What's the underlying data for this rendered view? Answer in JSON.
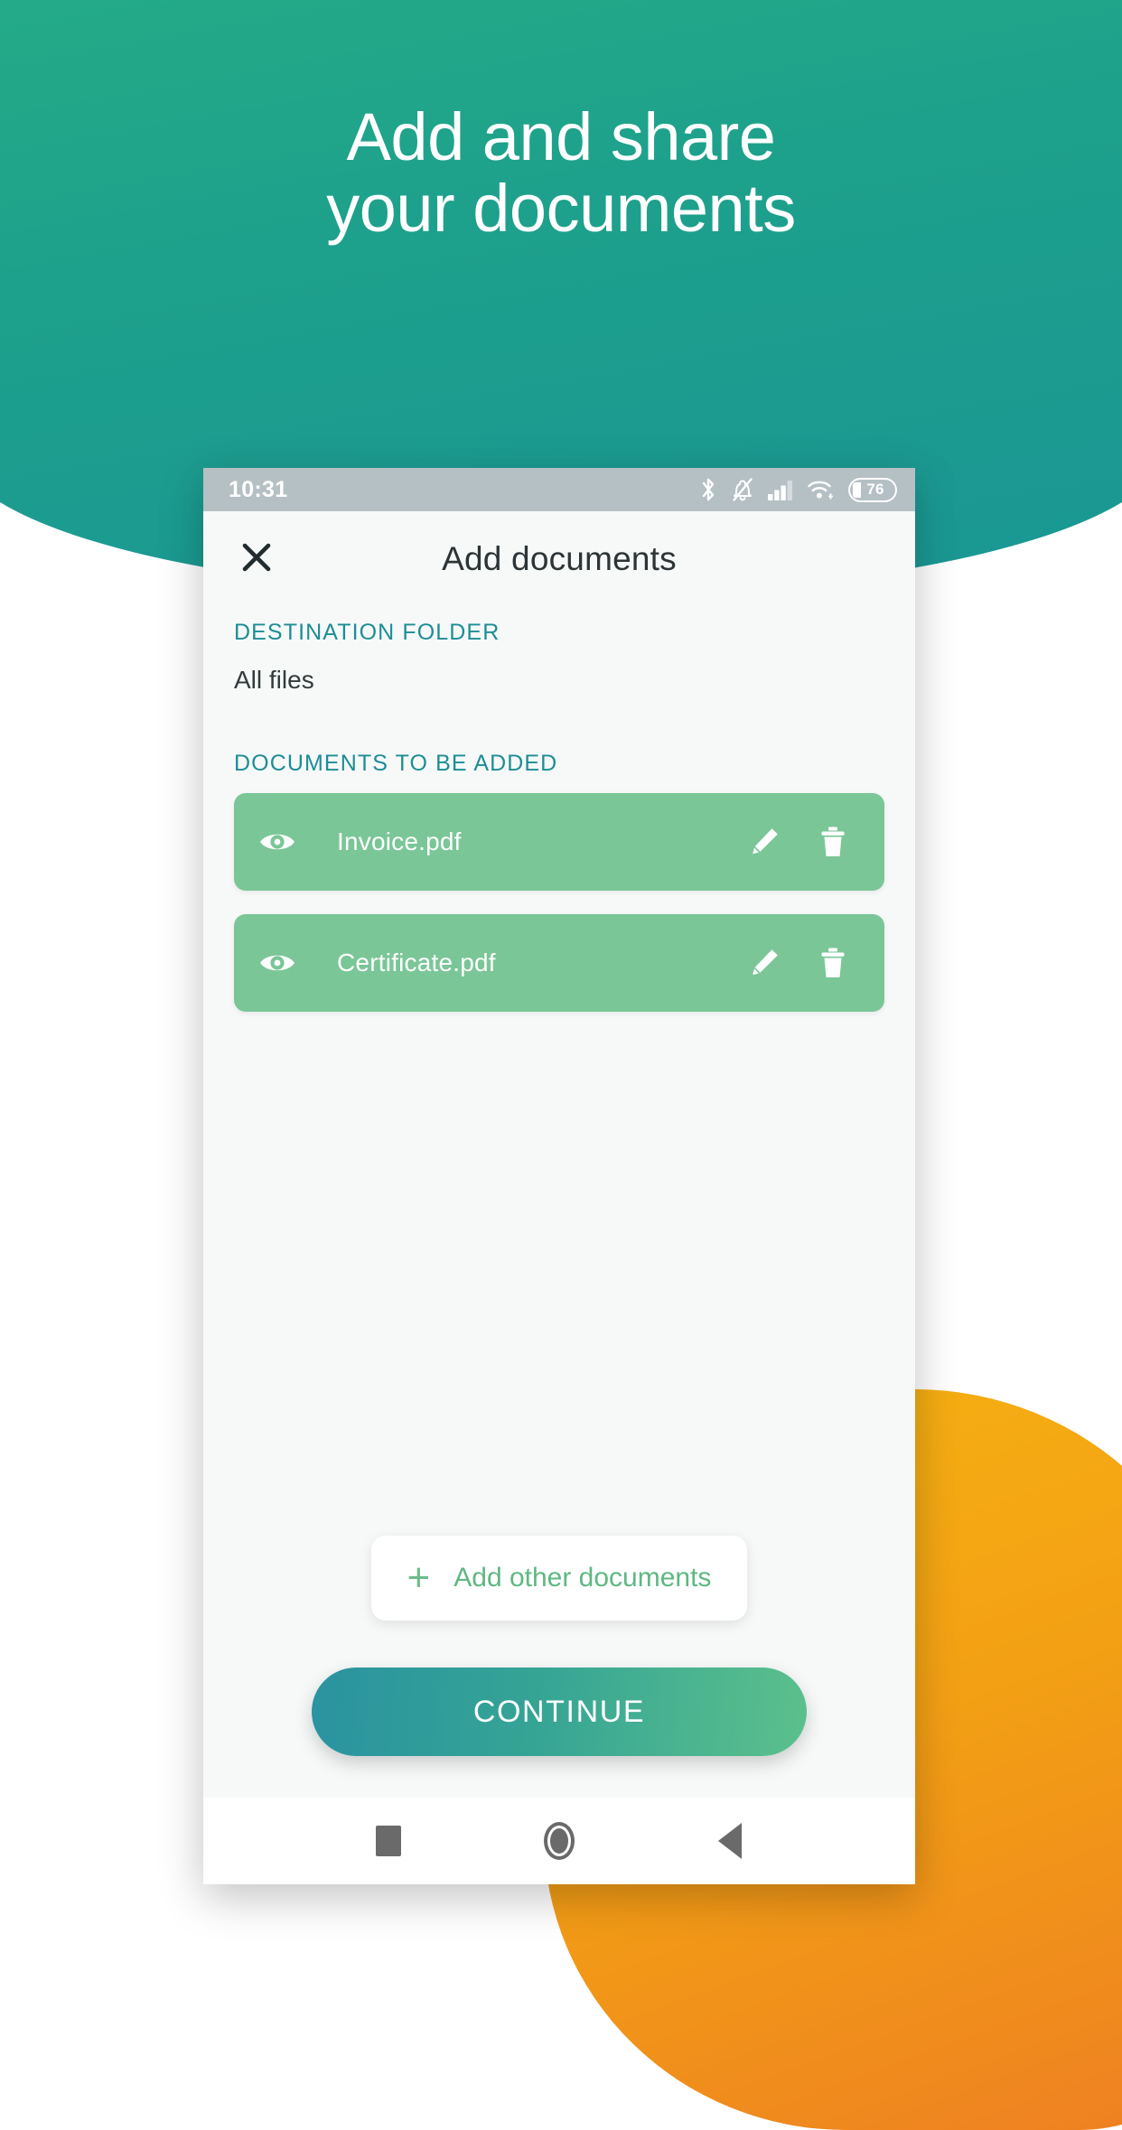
{
  "hero": {
    "headline": "Add and share\nyour documents"
  },
  "colors": {
    "teal_top": "#25AC87",
    "teal_bottom": "#1A9694",
    "orange_top": "#F6B312",
    "orange_bottom": "#EE7F22",
    "row_green": "#7AC697",
    "accent_label": "#1D8D95",
    "continue_from": "#2A93A0",
    "continue_to": "#5CC08C"
  },
  "statusbar": {
    "time": "10:31",
    "battery_level": "76",
    "icons": [
      "bluetooth-icon",
      "notifications-off-icon",
      "signal-bars-icon",
      "wifi-icon",
      "battery-icon"
    ]
  },
  "appbar": {
    "close_icon": "close-icon",
    "title": "Add documents"
  },
  "destination": {
    "label": "DESTINATION FOLDER",
    "value": "All files"
  },
  "documents": {
    "label": "DOCUMENTS TO BE ADDED",
    "items": [
      {
        "name": "Invoice.pdf",
        "preview_icon": "eye-icon",
        "edit_icon": "pencil-icon",
        "delete_icon": "trash-icon"
      },
      {
        "name": "Certificate.pdf",
        "preview_icon": "eye-icon",
        "edit_icon": "pencil-icon",
        "delete_icon": "trash-icon"
      }
    ]
  },
  "actions": {
    "add_other_label": "Add other documents",
    "add_other_icon": "plus-icon",
    "continue_label": "CONTINUE"
  },
  "navbar": {
    "recents": "square-recents-icon",
    "home": "circle-home-icon",
    "back": "triangle-back-icon"
  }
}
